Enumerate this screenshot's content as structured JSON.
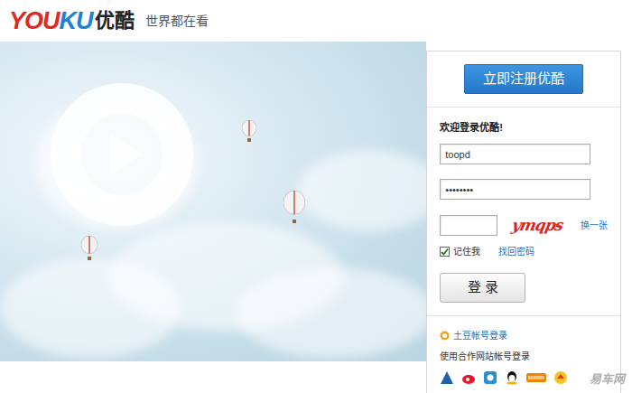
{
  "header": {
    "logo": "YOUKU",
    "brand": "优酷",
    "slogan": "世界都在看"
  },
  "login": {
    "register_button": "立即注册优酷",
    "welcome": "欢迎登录优酷!",
    "username": "toopd",
    "password": "••••••••",
    "captcha_code": "ymqps",
    "captcha_refresh": "换一张",
    "remember": {
      "label": "记住我",
      "checked": true
    },
    "forgot": "找回密码",
    "submit": "登 录",
    "tudou_login": "土豆帐号登录",
    "partner_label": "使用合作网站帐号登录"
  },
  "watermark": "易车网"
}
